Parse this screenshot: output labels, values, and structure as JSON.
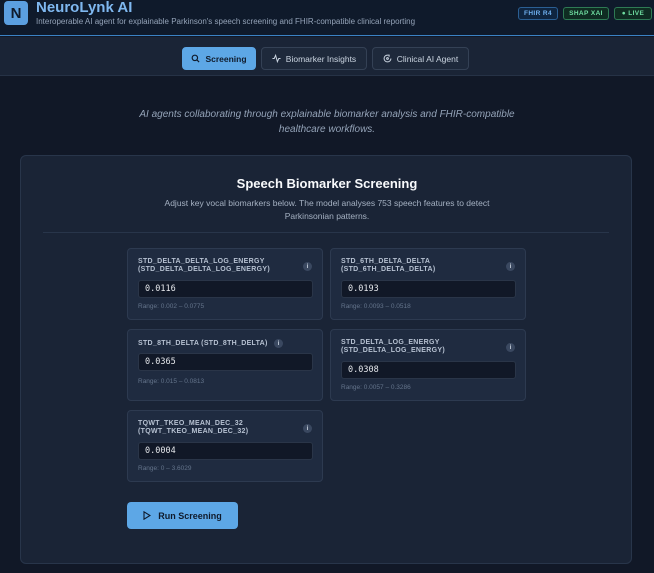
{
  "header": {
    "logo_letter": "N",
    "title": "NeuroLynk AI",
    "subtitle": "Interoperable AI agent for explainable Parkinson's speech screening and FHIR-compatible clinical reporting",
    "badges": [
      "FHIR R4",
      "SHAP XAI",
      "● LIVE"
    ]
  },
  "nav": {
    "tabs": [
      {
        "label": "Screening",
        "icon": "search-icon",
        "active": true
      },
      {
        "label": "Biomarker Insights",
        "icon": "activity-icon",
        "active": false
      },
      {
        "label": "Clinical AI Agent",
        "icon": "agent-icon",
        "active": false
      }
    ]
  },
  "tagline": "AI agents collaborating through explainable biomarker analysis and FHIR-compatible healthcare workflows.",
  "screening": {
    "title": "Speech Biomarker Screening",
    "description": "Adjust key vocal biomarkers below. The model analyses 753 speech features to detect Parkinsonian patterns.",
    "fields": [
      {
        "label": "STD_DELTA_DELTA_LOG_ENERGY (STD_DELTA_DELTA_LOG_ENERGY)",
        "value": "0.0116",
        "range": "Range: 0.002 – 0.0775"
      },
      {
        "label": "STD_6TH_DELTA_DELTA (STD_6TH_DELTA_DELTA)",
        "value": "0.0193",
        "range": "Range: 0.0093 – 0.0518"
      },
      {
        "label": "STD_8TH_DELTA (STD_8TH_DELTA)",
        "value": "0.0365",
        "range": "Range: 0.015 – 0.0813"
      },
      {
        "label": "STD_DELTA_LOG_ENERGY (STD_DELTA_LOG_ENERGY)",
        "value": "0.0308",
        "range": "Range: 0.0057 – 0.3286"
      },
      {
        "label": "TQWT_TKEO_MEAN_DEC_32 (TQWT_TKEO_MEAN_DEC_32)",
        "value": "0.0004",
        "range": "Range: 0 – 3.6029"
      }
    ],
    "info_glyph": "i",
    "run_label": "Run Screening"
  },
  "colors": {
    "accent": "#5da7e6",
    "background": "#111827",
    "card": "#1a2436",
    "live_green": "#6fdca0"
  }
}
